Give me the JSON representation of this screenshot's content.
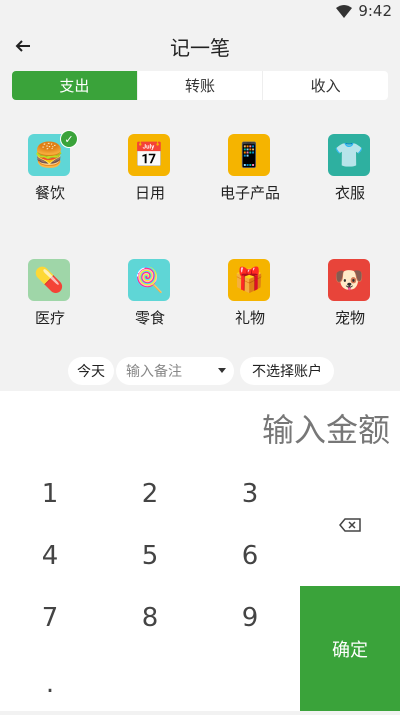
{
  "status": {
    "time": "9:42"
  },
  "header": {
    "title": "记一笔",
    "back_icon": "arrow-left-icon"
  },
  "tabs": [
    {
      "label": "支出",
      "active": true
    },
    {
      "label": "转账",
      "active": false
    },
    {
      "label": "收入",
      "active": false
    }
  ],
  "categories": [
    {
      "label": "餐饮",
      "icon": "burger-icon",
      "color": "#5fd6d6",
      "selected": true
    },
    {
      "label": "日用",
      "icon": "calendar-icon",
      "color": "#f5b400"
    },
    {
      "label": "电子产品",
      "icon": "phone-icon",
      "color": "#f5b400"
    },
    {
      "label": "衣服",
      "icon": "shirt-icon",
      "color": "#2eb0a0"
    },
    {
      "label": "医疗",
      "icon": "pills-icon",
      "color": "#9fd6a8"
    },
    {
      "label": "零食",
      "icon": "lollipop-icon",
      "color": "#5fd6d6"
    },
    {
      "label": "礼物",
      "icon": "gift-icon",
      "color": "#f5b400"
    },
    {
      "label": "宠物",
      "icon": "dog-icon",
      "color": "#e8443a"
    }
  ],
  "options": {
    "date": "今天",
    "note_placeholder": "输入备注",
    "account": "不选择账户"
  },
  "keypad": {
    "amount_placeholder": "输入金额",
    "keys": [
      "1",
      "2",
      "3",
      "4",
      "5",
      "6",
      "7",
      "8",
      "9",
      "."
    ],
    "delete_icon": "backspace-icon",
    "confirm": "确定"
  }
}
